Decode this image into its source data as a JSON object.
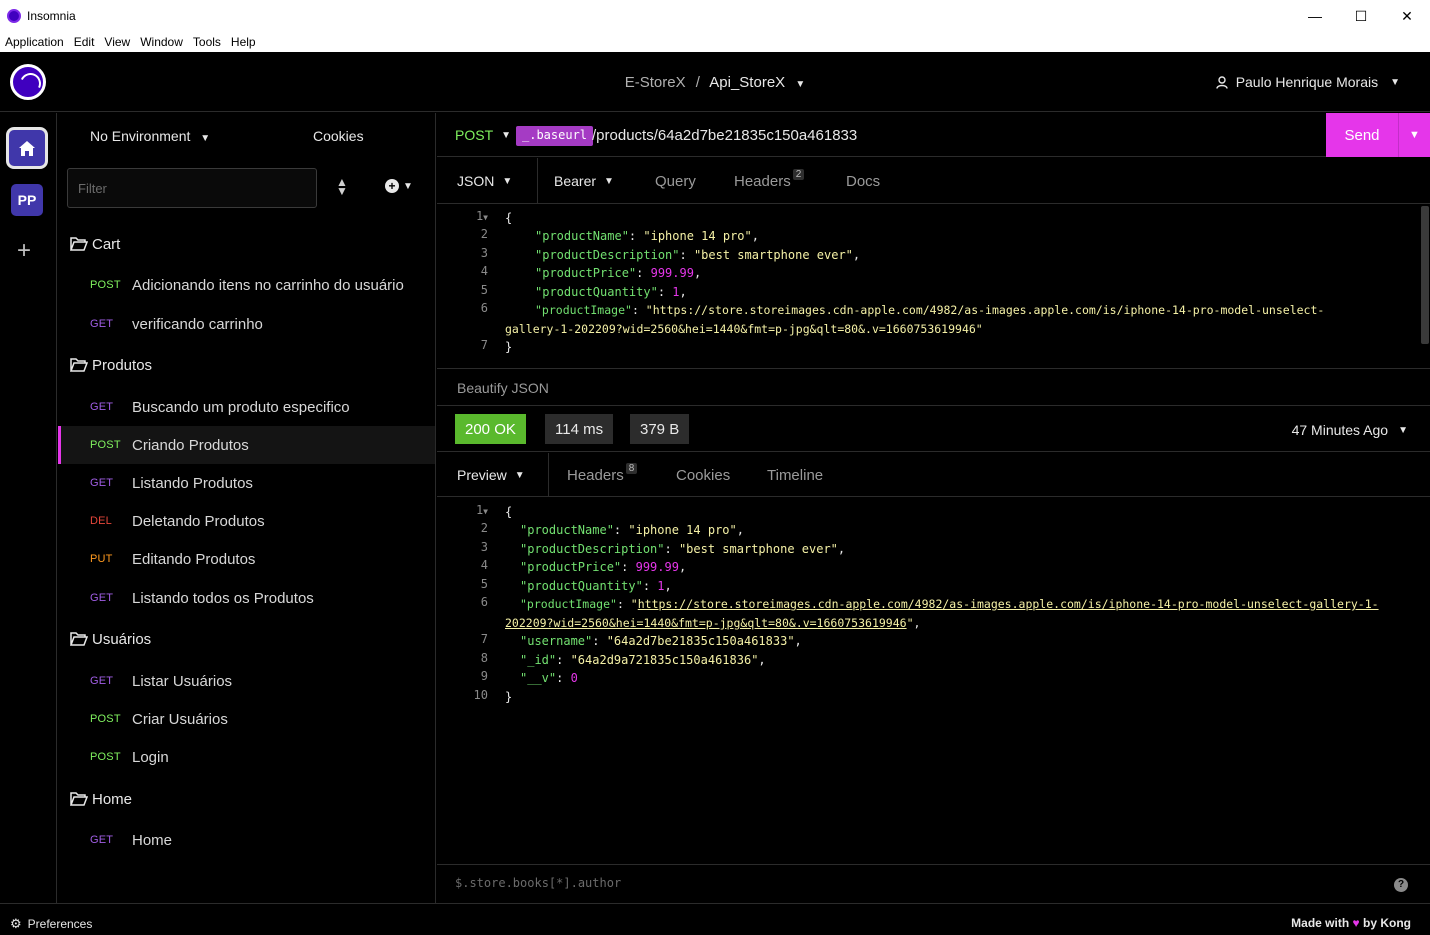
{
  "window": {
    "title": "Insomnia",
    "menu": [
      "Application",
      "Edit",
      "View",
      "Window",
      "Tools",
      "Help"
    ]
  },
  "header": {
    "workspace": "E-StoreX",
    "separator": "/",
    "project": "Api_StoreX",
    "user": "Paulo Henrique Morais"
  },
  "rail": {
    "project_badge": "PP",
    "add_symbol": "+"
  },
  "sidebar": {
    "environment": "No Environment",
    "cookies": "Cookies",
    "filter_placeholder": "Filter",
    "folders": [
      {
        "name": "Cart"
      },
      {
        "name": "Produtos"
      },
      {
        "name": "Usuários"
      },
      {
        "name": "Home"
      }
    ],
    "requests": [
      {
        "method": "POST",
        "name": "Adicionando itens no carrinho do usuário"
      },
      {
        "method": "GET",
        "name": "verificando carrinho"
      },
      {
        "method": "GET",
        "name": "Buscando um produto especifico"
      },
      {
        "method": "POST",
        "name": "Criando Produtos"
      },
      {
        "method": "GET",
        "name": "Listando Produtos"
      },
      {
        "method": "DEL",
        "name": "Deletando Produtos"
      },
      {
        "method": "PUT",
        "name": "Editando Produtos"
      },
      {
        "method": "GET",
        "name": "Listando todos os Produtos"
      },
      {
        "method": "GET",
        "name": "Listar Usuários"
      },
      {
        "method": "POST",
        "name": "Criar Usuários"
      },
      {
        "method": "POST",
        "name": "Login"
      },
      {
        "method": "GET",
        "name": "Home"
      }
    ]
  },
  "request": {
    "method": "POST",
    "base_tag": "_.baseurl",
    "path": "/products/64a2d7be21835c150a461833",
    "send": "Send",
    "tabs": {
      "body": "JSON",
      "auth": "Bearer",
      "query": "Query",
      "headers": "Headers",
      "headers_count": "2",
      "docs": "Docs"
    },
    "body_lines": {
      "l1": "{",
      "k2": "\"productName\"",
      "v2": "\"iphone 14 pro\"",
      "k3": "\"productDescription\"",
      "v3": "\"best smartphone ever\"",
      "k4": "\"productPrice\"",
      "v4": "999.99",
      "k5": "\"productQuantity\"",
      "v5": "1",
      "k6": "\"productImage\"",
      "v6a": "\"https://store.storeimages.cdn-apple.com/4982/as-images.apple.com/is/iphone-14-pro-model-unselect-",
      "v6b": "gallery-1-202209?wid=2560&hei=1440&fmt=p-jpg&qlt=80&.v=1660753619946\"",
      "l7": "}"
    },
    "beautify": "Beautify JSON"
  },
  "response": {
    "status": "200 OK",
    "time": "114 ms",
    "size": "379 B",
    "age": "47 Minutes Ago",
    "tabs": {
      "preview": "Preview",
      "headers": "Headers",
      "headers_count": "8",
      "cookies": "Cookies",
      "timeline": "Timeline"
    },
    "body_lines": {
      "l1": "{",
      "k2": "\"productName\"",
      "v2": "\"iphone 14 pro\"",
      "k3": "\"productDescription\"",
      "v3": "\"best smartphone ever\"",
      "k4": "\"productPrice\"",
      "v4": "999.99",
      "k5": "\"productQuantity\"",
      "v5": "1",
      "k6": "\"productImage\"",
      "v6a": "https://store.storeimages.cdn-apple.com/4982/as-images.apple.com/is/iphone-14-pro-model-unselect-gallery-1-",
      "v6b": "202209?wid=2560&hei=1440&fmt=p-jpg&qlt=80&.v=1660753619946",
      "k7": "\"username\"",
      "v7": "\"64a2d7be21835c150a461833\"",
      "k8": "\"_id\"",
      "v8": "\"64a2d9a721835c150a461836\"",
      "k9": "\"__v\"",
      "v9": "0",
      "l10": "}"
    },
    "filter_placeholder": "$.store.books[*].author"
  },
  "footer": {
    "preferences": "Preferences",
    "made_with": "Made with",
    "by": "by Kong"
  },
  "colors": {
    "accent": "#e536ea",
    "get": "#a15ee5",
    "post": "#7ff05e",
    "delete": "#e5463a",
    "put": "#ff9a1f",
    "ok": "#5ab92d"
  }
}
